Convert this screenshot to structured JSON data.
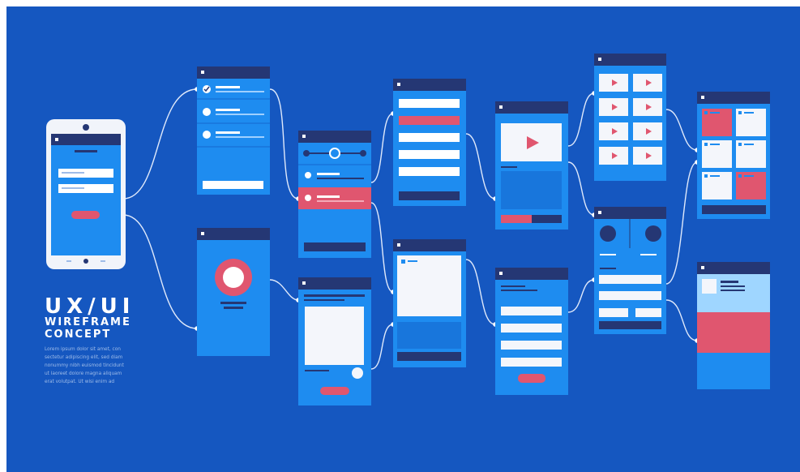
{
  "title": "UX/UI",
  "subtitle_line1": "WIREFRAME",
  "subtitle_line2": "CONCEPT",
  "body_lines": [
    "Lorem ipsum dolor sit amet, con",
    "sectetur adipiscing elit, sed diam",
    "nonummy nibh euismod tincidunt",
    "ut laoreet dolore magna aliquam",
    "erat volutpat. Ut wisi enim ad"
  ],
  "colors": {
    "background": "#1557c0",
    "screen": "#1e8cf0",
    "header": "#253774",
    "accent": "#e0566f",
    "card": "#f4f6fb",
    "phone_body": "#f1f4fa"
  },
  "icons": [
    "play-icon",
    "play-icon",
    "play-icon",
    "play-icon",
    "play-icon",
    "play-icon",
    "play-icon",
    "play-icon",
    "play-icon",
    "checkmark-icon"
  ]
}
